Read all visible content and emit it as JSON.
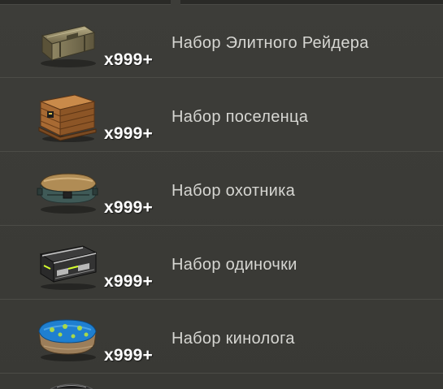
{
  "items": [
    {
      "icon": "elite-raider-crate-icon",
      "quantity": "x999+",
      "name": "Набор Элитного Рейдера"
    },
    {
      "icon": "settler-wooden-crate-icon",
      "quantity": "x999+",
      "name": "Набор поселенца"
    },
    {
      "icon": "hunter-chest-icon",
      "quantity": "x999+",
      "name": "Набор охотника"
    },
    {
      "icon": "loner-case-icon",
      "quantity": "x999+",
      "name": "Набор одиночки"
    },
    {
      "icon": "dog-handler-pet-bed-icon",
      "quantity": "x999+",
      "name": "Набор кинолога"
    }
  ],
  "colors": {
    "background": "#3a3a36",
    "divider": "#4c4c47",
    "quantity_text": "#ffffff",
    "name_text": "#d6d6d2"
  }
}
